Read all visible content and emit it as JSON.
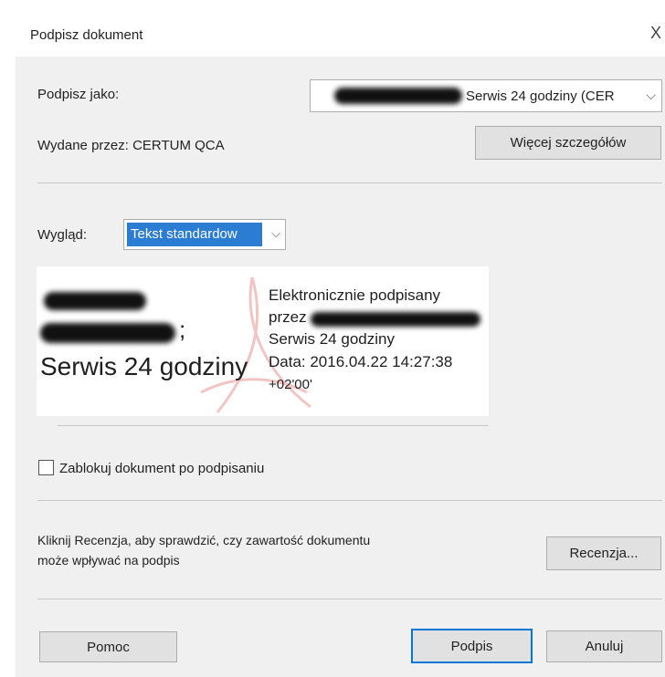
{
  "dialog": {
    "title": "Podpisz dokument",
    "close_glyph": "X"
  },
  "sign_as": {
    "label": "Podpisz jako:",
    "value_visible": "Serwis 24 godziny (CER",
    "chevron": "⌵"
  },
  "issuer": {
    "label": "Wydane przez: CERTUM QCA",
    "details_button": "Więcej szczegółów"
  },
  "appearance": {
    "label": "Wygląd:",
    "selected": "Tekst standardow",
    "chevron": "⌵"
  },
  "preview": {
    "semicolon": ";",
    "company": "Serwis 24 godziny",
    "line1": "Elektronicznie podpisany",
    "line2_prefix": "przez",
    "line3": "Serwis 24 godziny",
    "line4": "Data: 2016.04.22 14:27:38",
    "line5": "+02'00'"
  },
  "lock_option": {
    "label": "Zablokuj dokument po podpisaniu",
    "checked": false
  },
  "review": {
    "text_line1": "Kliknij Recenzja, aby sprawdzić, czy zawartość dokumentu",
    "text_line2": "może wpływać na podpis",
    "button": "Recenzja..."
  },
  "footer": {
    "help_button": "Pomoc",
    "sign_button": "Podpis",
    "cancel_button": "Anuluj"
  },
  "colors": {
    "dialog_bg": "#f0f0f0",
    "selection_bg": "#2b7cd3",
    "default_button_border": "#0078d7",
    "button_bg": "#e1e1e1"
  }
}
